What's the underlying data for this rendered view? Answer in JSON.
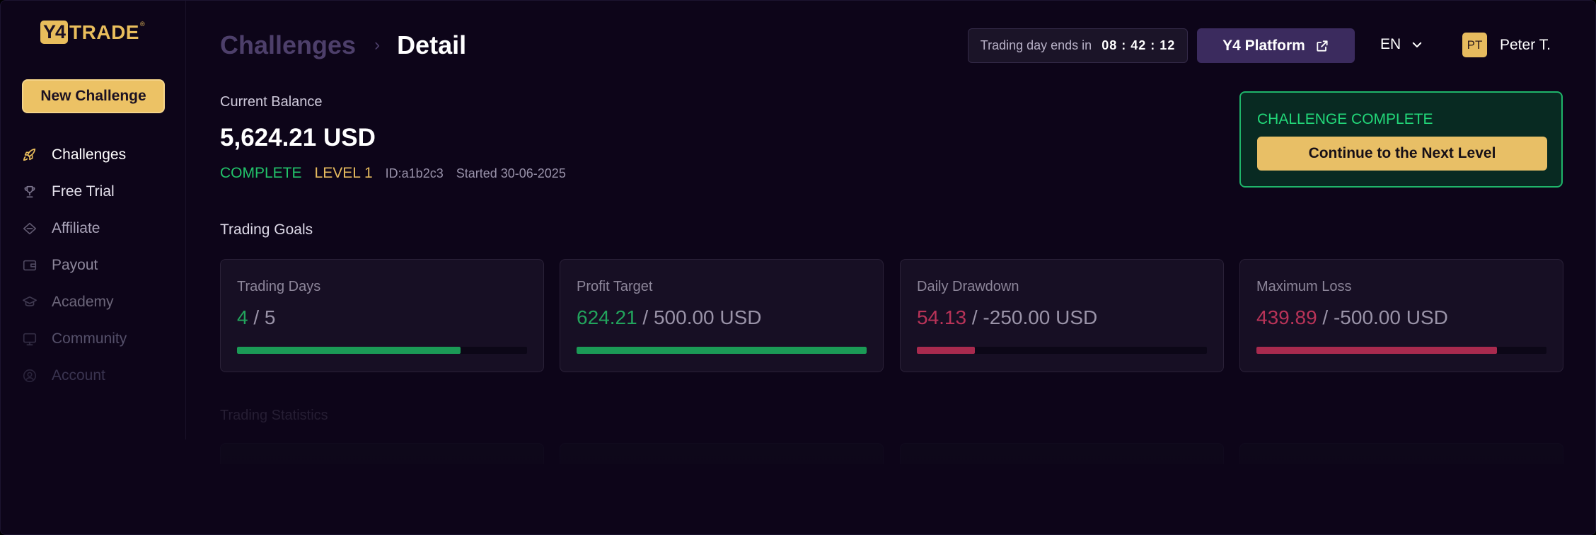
{
  "logo": {
    "box": "Y4",
    "text": "TRADE",
    "reg": "®"
  },
  "sidebar": {
    "new_challenge": "New Challenge",
    "items": [
      {
        "label": "Challenges",
        "icon": "rocket-icon",
        "color": "#ffffff"
      },
      {
        "label": "Free Trial",
        "icon": "trophy-icon",
        "color": "#e2dfea"
      },
      {
        "label": "Affiliate",
        "icon": "diamond-icon",
        "color": "#a9a3b8"
      },
      {
        "label": "Payout",
        "icon": "wallet-icon",
        "color": "#8d879b"
      },
      {
        "label": "Academy",
        "icon": "graduation-cap-icon",
        "color": "#6c667a"
      },
      {
        "label": "Community",
        "icon": "monitor-icon",
        "color": "#55506a"
      },
      {
        "label": "Account",
        "icon": "user-circle-icon",
        "color": "#3a3450"
      }
    ]
  },
  "header": {
    "breadcrumb_parent": "Challenges",
    "breadcrumb_current": "Detail",
    "timer_label": "Trading day ends in",
    "timer_value": "08 : 42 : 12",
    "platform": "Y4 Platform",
    "language": "EN",
    "user_initials": "PT",
    "user_name": "Peter T."
  },
  "balance": {
    "label": "Current Balance",
    "value": "5,624.21 USD",
    "status": "COMPLETE",
    "level": "LEVEL 1",
    "id": "ID:a1b2c3",
    "started": "Started 30-06-2025"
  },
  "complete_card": {
    "title": "CHALLENGE COMPLETE",
    "button": "Continue to the Next Level"
  },
  "goals": {
    "title": "Trading Goals",
    "cards": [
      {
        "label": "Trading Days",
        "current": "4",
        "rest": " / 5",
        "tone": "green",
        "progress": 0.77
      },
      {
        "label": "Profit Target",
        "current": "624.21",
        "rest": " / 500.00 USD",
        "tone": "green",
        "progress": 1.0
      },
      {
        "label": "Daily Drawdown",
        "current": "54.13",
        "rest": " / -250.00 USD",
        "tone": "red",
        "progress": 0.2
      },
      {
        "label": "Maximum Loss",
        "current": "439.89",
        "rest": " / -500.00 USD",
        "tone": "red",
        "progress": 0.83
      }
    ]
  },
  "stats": {
    "title": "Trading Statistics"
  },
  "colors": {
    "accent_gold": "#e8bd5c",
    "success": "#22c36a",
    "danger": "#b83358",
    "background": "#0d0519"
  }
}
